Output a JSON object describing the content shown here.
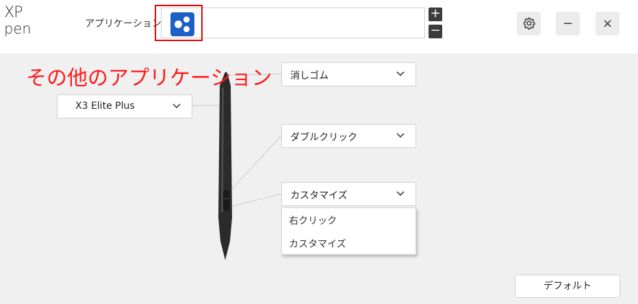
{
  "brand": {
    "logo_top": "XP",
    "logo_bottom": "pen"
  },
  "header": {
    "app_label": "アプリケーション",
    "add_symbol": "+",
    "remove_symbol": "−",
    "minimize_symbol": "−",
    "close_symbol": "×"
  },
  "overlay_title": "その他のアプリケーション",
  "device_select": {
    "value": "X3 Elite Plus"
  },
  "pen_buttons": {
    "top": "消しゴム",
    "upper": "ダブルクリック",
    "lower": "カスタマイズ"
  },
  "lower_menu": {
    "options": [
      "右クリック",
      "カスタマイズ"
    ]
  },
  "footer": {
    "default_label": "デフォルト"
  },
  "colors": {
    "highlight": "#e60000",
    "app_icon": "#1e5fc6",
    "annotation": "#ff1a1a"
  },
  "icons": {
    "settings": "gear-icon",
    "app": "other-apps-icon",
    "dropdown": "chevron-down-icon"
  }
}
